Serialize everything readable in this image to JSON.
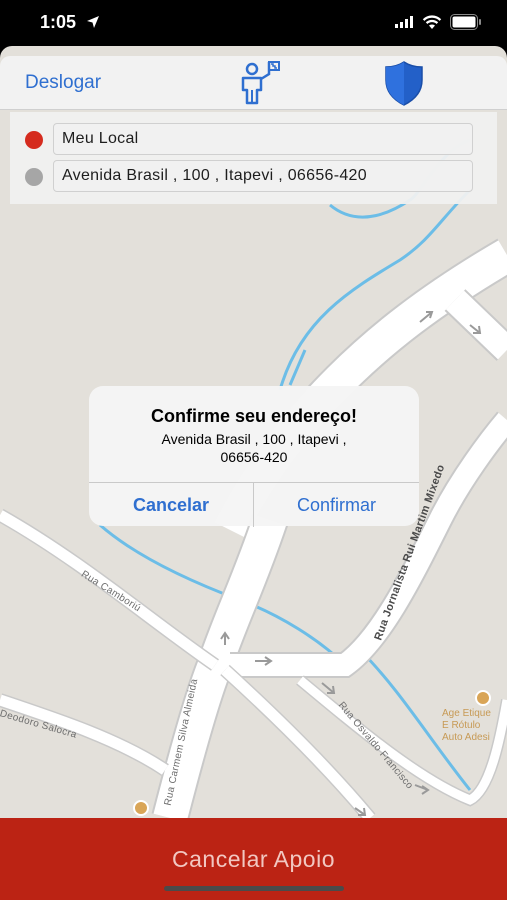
{
  "status": {
    "time": "1:05"
  },
  "header": {
    "logout_label": "Deslogar"
  },
  "route": {
    "origin": {
      "label": "Meu Local",
      "dot_color": "#d52b1e"
    },
    "destination": {
      "label": "Avenida Brasil , 100   , Itapevi , 06656-420",
      "dot_color": "#a6a6a6"
    }
  },
  "alert": {
    "title": "Confirme seu endereço!",
    "message_line1": "Avenida Brasil , 100   , Itapevi ,",
    "message_line2": "06656-420",
    "cancel_label": "Cancelar",
    "confirm_label": "Confirmar"
  },
  "map": {
    "streets": [
      "Rua Camboriú",
      "Rua Jornalista Rui Martim Mixedo",
      "Rua Carmem Silva Almeida",
      "Rua Osvaldo Francisco",
      "Deodoro Salocra"
    ],
    "poi_line1": "Age Etique",
    "poi_line2": "E Rótulo",
    "poi_line3": "Auto Adesi"
  },
  "bottom": {
    "cancel_support_label": "Cancelar Apoio"
  },
  "colors": {
    "accent": "#2f6fd0",
    "danger": "#bb2314",
    "map_bg": "#e3e0da",
    "water": "#5ab4e0"
  }
}
